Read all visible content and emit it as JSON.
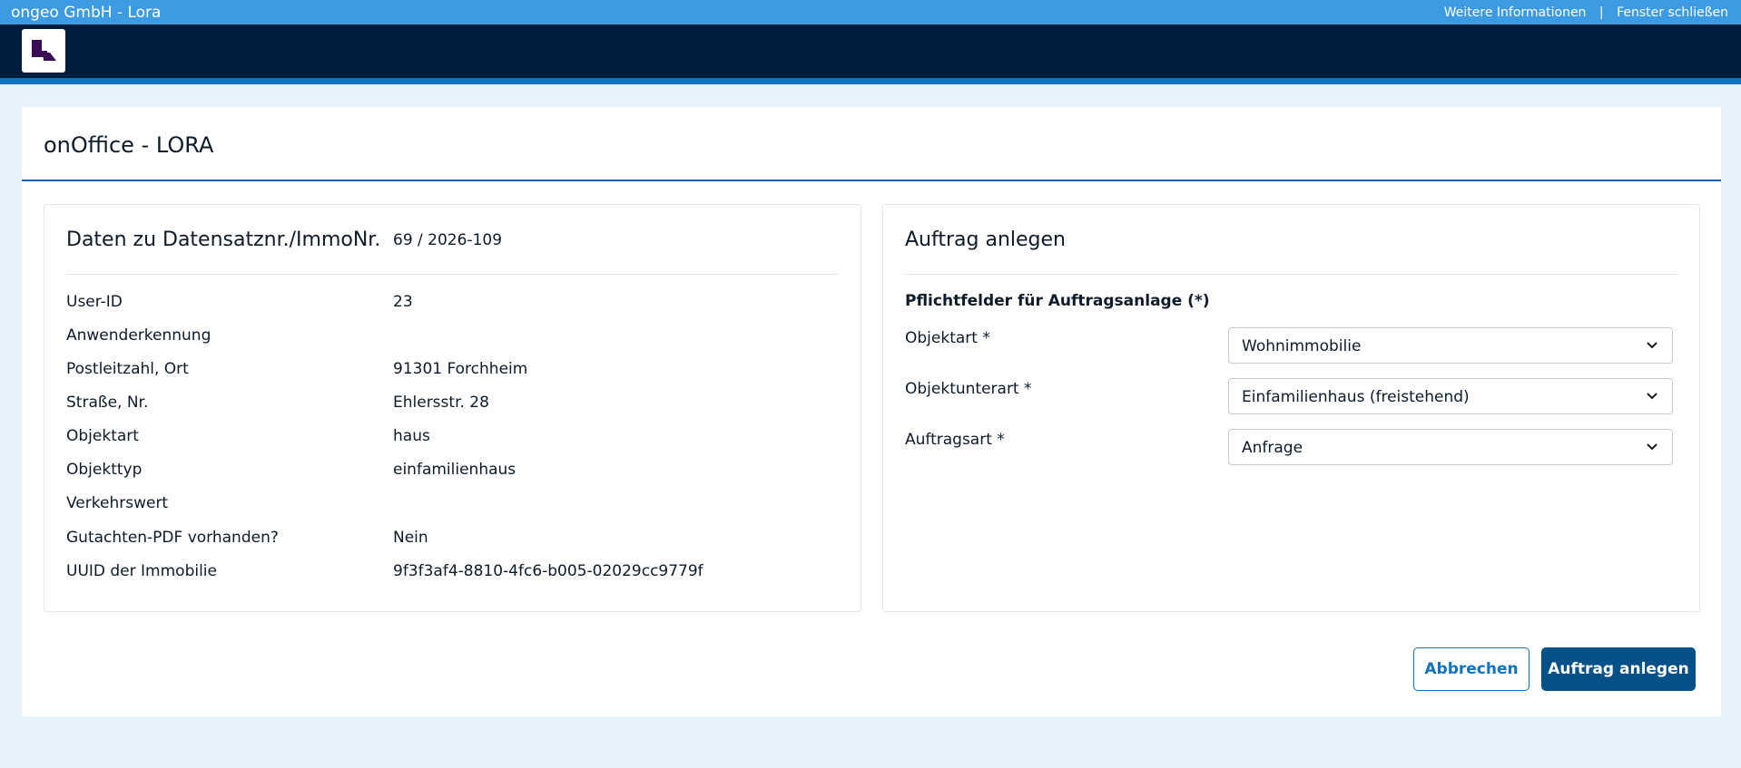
{
  "window": {
    "title": "ongeo GmbH - Lora",
    "more_info": "Weitere Informationen",
    "separator": "|",
    "close_window": "Fenster schließen"
  },
  "page": {
    "title": "onOffice - LORA"
  },
  "data_panel": {
    "title": "Daten zu Datensatznr./ImmoNr.",
    "record_number": "69 / 2026-109",
    "rows": [
      {
        "label": "User-ID",
        "value": "23"
      },
      {
        "label": "Anwenderkennung",
        "value": ""
      },
      {
        "label": "Postleitzahl, Ort",
        "value": "91301 Forchheim"
      },
      {
        "label": "Straße, Nr.",
        "value": "Ehlersstr. 28"
      },
      {
        "label": "Objektart",
        "value": "haus"
      },
      {
        "label": "Objekttyp",
        "value": "einfamilienhaus"
      },
      {
        "label": "Verkehrswert",
        "value": ""
      },
      {
        "label": "Gutachten-PDF vorhanden?",
        "value": "Nein"
      },
      {
        "label": "UUID der Immobilie",
        "value": "9f3f3af4-8810-4fc6-b005-02029cc9779f"
      }
    ]
  },
  "order_panel": {
    "title": "Auftrag anlegen",
    "required_heading": "Pflichtfelder für Auftragsanlage (*)",
    "fields": [
      {
        "label": "Objektart *",
        "value": "Wohnimmobilie"
      },
      {
        "label": "Objektunterart *",
        "value": "Einfamilienhaus (freistehend)"
      },
      {
        "label": "Auftragsart *",
        "value": "Anfrage"
      }
    ]
  },
  "actions": {
    "cancel_label": "Abbrechen",
    "submit_label": "Auftrag anlegen"
  },
  "colors": {
    "topbar": "#3d9be3",
    "navbar": "#011d3d",
    "accent": "#0e73c0",
    "primary_button": "#045189",
    "logo_purple": "#3a0d59"
  },
  "icons": {
    "logo": "lora-logo-icon",
    "select_chevron": "chevron-down-icon"
  }
}
